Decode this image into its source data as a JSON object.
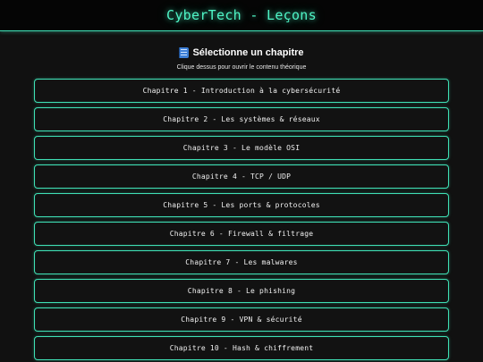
{
  "header": {
    "title": "CyberTech - Leçons"
  },
  "section": {
    "icon": "book-icon",
    "title": "Sélectionne un chapitre",
    "subtitle": "Clique dessus pour ouvrir le contenu théorique"
  },
  "colors": {
    "accent": "#3fe0b5",
    "title_glow": "#4ff5c6",
    "background": "#111111",
    "icon_blue": "#3d7fd6"
  },
  "chapters": [
    {
      "label": "Chapitre 1 - Introduction à la cybersécurité"
    },
    {
      "label": "Chapitre 2 - Les systèmes & réseaux"
    },
    {
      "label": "Chapitre 3 - Le modèle OSI"
    },
    {
      "label": "Chapitre 4 - TCP / UDP"
    },
    {
      "label": "Chapitre 5 - Les ports & protocoles"
    },
    {
      "label": "Chapitre 6 - Firewall & filtrage"
    },
    {
      "label": "Chapitre 7 - Les malwares"
    },
    {
      "label": "Chapitre 8 - Le phishing"
    },
    {
      "label": "Chapitre 9 - VPN & sécurité"
    },
    {
      "label": "Chapitre 10 - Hash & chiffrement"
    }
  ]
}
